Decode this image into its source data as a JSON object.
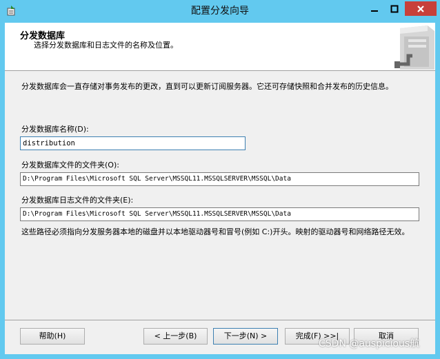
{
  "window": {
    "title": "配置分发向导"
  },
  "header": {
    "title": "分发数据库",
    "subtitle": "选择分发数据库和日志文件的名称及位置。"
  },
  "description": "分发数据库会一直存储对事务发布的更改，直到可以更新订阅服务器。它还可存储快照和合并发布的历史信息。",
  "fields": {
    "name_label": "分发数据库名称(D):",
    "name_value": "distribution",
    "data_folder_label": "分发数据库文件的文件夹(O):",
    "data_folder_value": "D:\\Program Files\\Microsoft SQL Server\\MSSQL11.MSSQLSERVER\\MSSQL\\Data",
    "log_folder_label": "分发数据库日志文件的文件夹(E):",
    "log_folder_value": "D:\\Program Files\\Microsoft SQL Server\\MSSQL11.MSSQLSERVER\\MSSQL\\Data"
  },
  "note": "这些路径必须指向分发服务器本地的磁盘并以本地驱动器号和冒号(例如 C:)开头。映射的驱动器号和网络路径无效。",
  "buttons": {
    "help": "帮助(H)",
    "back": "< 上一步(B)",
    "next": "下一步(N) >",
    "finish": "完成(F) >>|",
    "cancel": "取消"
  },
  "watermark": "CSDN @auspicious航",
  "icons": {
    "app": "wizard-icon",
    "minimize": "minimize-icon",
    "maximize": "maximize-icon",
    "close": "close-icon",
    "header": "server-icon"
  },
  "colors": {
    "titlebar": "#62c9ef",
    "close_button": "#c7403a",
    "client_bg": "#f0f0f0"
  }
}
